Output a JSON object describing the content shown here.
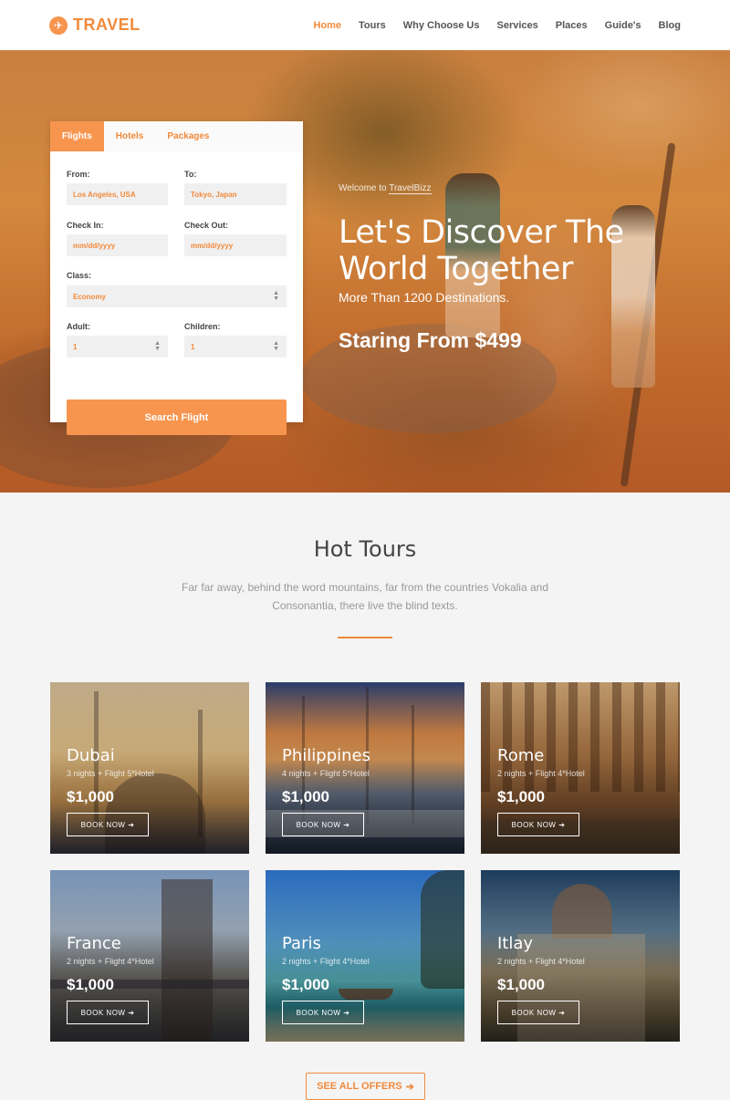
{
  "brand": {
    "name": "TRAVEL",
    "icon": "plane-icon"
  },
  "nav": {
    "items": [
      {
        "label": "Home",
        "active": true
      },
      {
        "label": "Tours"
      },
      {
        "label": "Why Choose Us"
      },
      {
        "label": "Services"
      },
      {
        "label": "Places"
      },
      {
        "label": "Guide's"
      },
      {
        "label": "Blog"
      }
    ]
  },
  "search": {
    "tabs": [
      "Flights",
      "Hotels",
      "Packages"
    ],
    "active_tab": "Flights",
    "from_label": "From:",
    "from_value": "Los Angeles, USA",
    "to_label": "To:",
    "to_value": "Tokyo, Japan",
    "checkin_label": "Check In:",
    "checkin_placeholder": "mm/dd/yyyy",
    "checkout_label": "Check Out:",
    "checkout_placeholder": "mm/dd/yyyy",
    "class_label": "Class:",
    "class_value": "Economy",
    "adult_label": "Adult:",
    "adult_value": "1",
    "children_label": "Children:",
    "children_value": "1",
    "button": "Search Flight"
  },
  "hero": {
    "welcome_prefix": "Welcome to ",
    "welcome_brand": "TravelBizz",
    "title": "Let's Discover The World Together",
    "subtitle": "More Than 1200 Destinations.",
    "price_line": "Staring From $499"
  },
  "hot_tours": {
    "title": "Hot Tours",
    "description": "Far far away, behind the word mountains, far from the countries Vokalia and Consonantia, there live the blind texts.",
    "book_label": "BOOK NOW",
    "cards": [
      {
        "name": "Dubai",
        "meta": "3 nights + Flight 5*Hotel",
        "price": "$1,000"
      },
      {
        "name": "Philippines",
        "meta": "4 nights + Flight 5*Hotel",
        "price": "$1,000"
      },
      {
        "name": "Rome",
        "meta": "2 nights + Flight 4*Hotel",
        "price": "$1,000"
      },
      {
        "name": "France",
        "meta": "2 nights + Flight 4*Hotel",
        "price": "$1,000"
      },
      {
        "name": "Paris",
        "meta": "2 nights + Flight 4*Hotel",
        "price": "$1,000"
      },
      {
        "name": "Itlay",
        "meta": "2 nights + Flight 4*Hotel",
        "price": "$1,000"
      }
    ],
    "see_all": "SEE ALL OFFERS"
  },
  "colors": {
    "accent": "#f7954e",
    "accent_text": "#f08a3c"
  }
}
